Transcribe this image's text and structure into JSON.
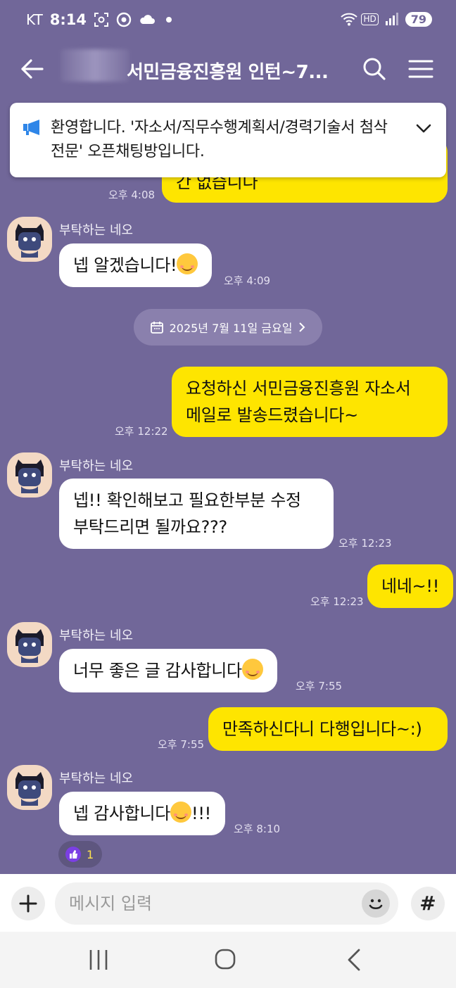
{
  "status_bar": {
    "carrier": "KT",
    "time": "8:14",
    "battery": "79",
    "network_badge": "HD"
  },
  "header": {
    "title": "서민금융진흥원 인턴~7..."
  },
  "notice": {
    "text": "환영합니다. '자소서/직무수행계획서/경력기술서 첨삭 전문' 오픈채팅방입니다."
  },
  "messages": [
    {
      "side": "right",
      "partial_text": "간 없습니다",
      "time": "오후 4:08"
    },
    {
      "side": "left",
      "sender": "부탁하는 네오",
      "text": "넵 알겠습니다!",
      "emoji": "smiling-face",
      "time": "오후 4:09"
    },
    {
      "side": "right",
      "lines": [
        "요청하신 서민금융진흥원 자소서",
        "메일로 발송드렸습니다~"
      ],
      "time": "오후 12:22"
    },
    {
      "side": "left",
      "sender": "부탁하는 네오",
      "lines": [
        "넵!! 확인해보고 필요한부분 수정",
        "부탁드리면 될까요???"
      ],
      "time": "오후 12:23"
    },
    {
      "side": "right",
      "text": "네네~!!",
      "time": "오후 12:23"
    },
    {
      "side": "left",
      "sender": "부탁하는 네오",
      "text": "너무 좋은 글 감사합니다",
      "emoji": "smiling-face",
      "time": "오후 7:55"
    },
    {
      "side": "right",
      "text": "만족하신다니 다행입니다~:)",
      "time": "오후 7:55"
    },
    {
      "side": "left",
      "sender": "부탁하는 네오",
      "text": "넵 감사합니다",
      "emoji": "smiling-face",
      "text_after": "!!!",
      "time": "오후 8:10",
      "reaction_count": "1"
    }
  ],
  "date_divider": "2025년 7월 11일 금요일",
  "input": {
    "placeholder": "메시지 입력",
    "hash_label": "#"
  },
  "colors": {
    "chat_background": "#716799",
    "my_bubble": "#fee500",
    "other_bubble": "#ffffff"
  }
}
